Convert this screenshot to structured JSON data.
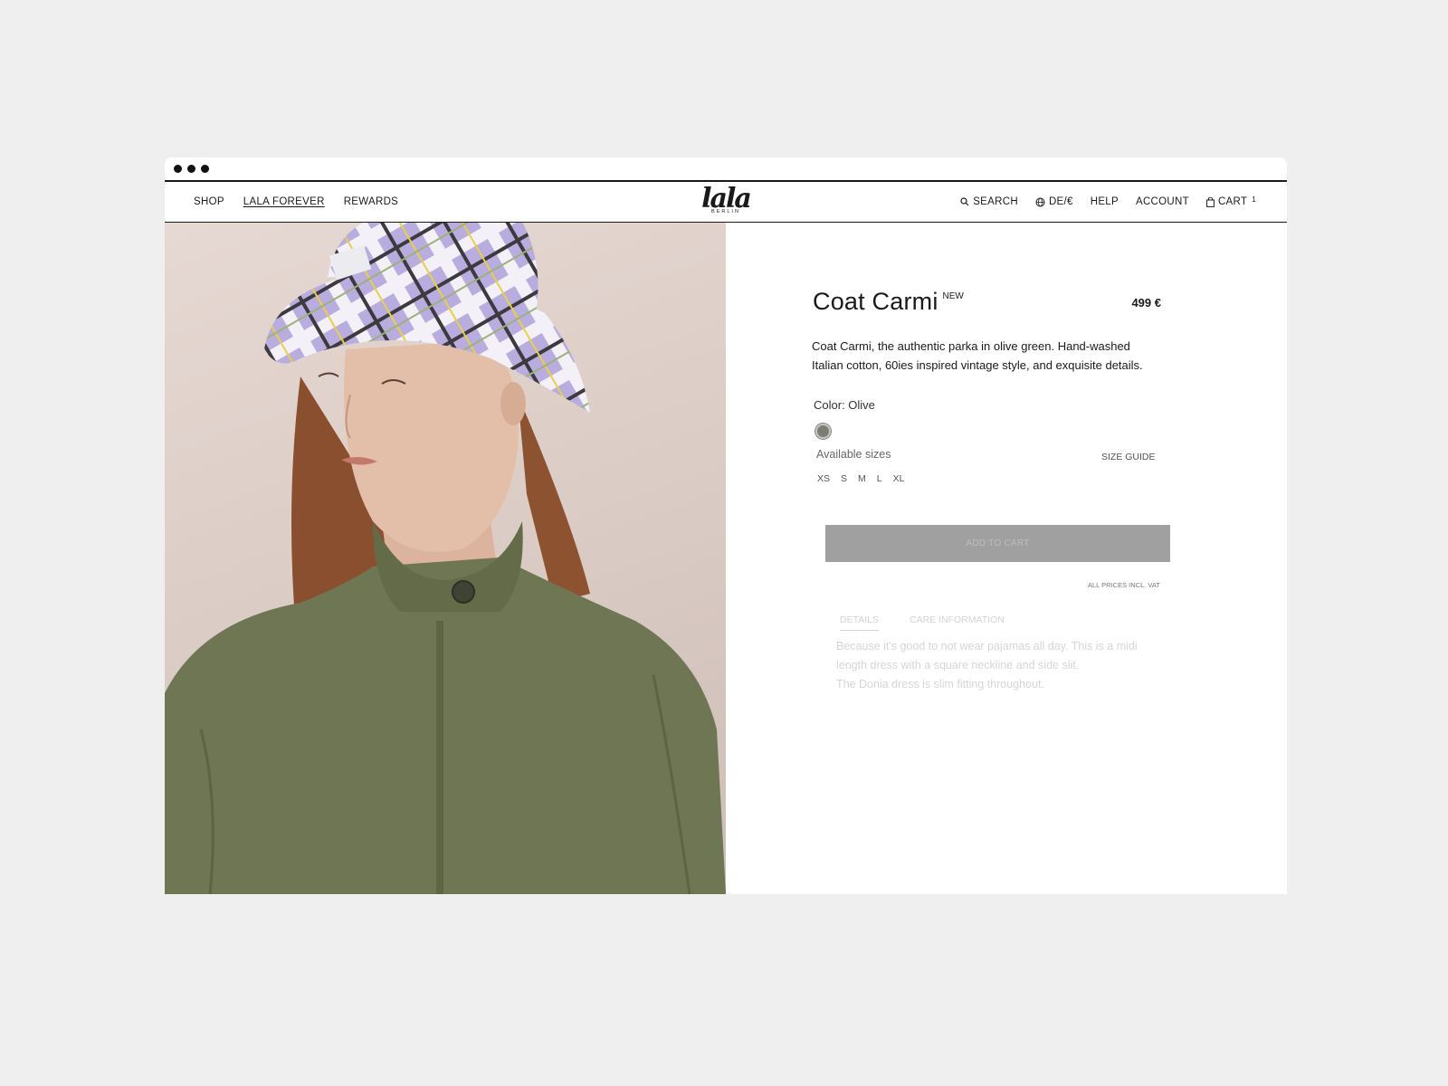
{
  "nav": {
    "left": [
      "SHOP",
      "LALA FOREVER",
      "REWARDS"
    ],
    "logo_script": "lala",
    "logo_sub": "BERLIN",
    "search": "SEARCH",
    "locale": "DE/€",
    "help": "HELP",
    "account": "ACCOUNT",
    "cart": "CART",
    "cart_count": "1"
  },
  "product": {
    "name": "Coat Carmi",
    "badge": "NEW",
    "price": "499 €",
    "description": "Coat Carmi, the authentic parka in olive green. Hand-washed Italian cotton, 60ies inspired vintage style, and exquisite details.",
    "color_label": "Color: Olive",
    "color_swatch": "#7b7e72",
    "available_sizes_label": "Available sizes",
    "size_guide": "SIZE GUIDE",
    "sizes": [
      "XS",
      "S",
      "M",
      "L",
      "XL"
    ],
    "add_to_cart": "ADD TO CART",
    "vat_note": "ALL PRICES INCL. VAT",
    "tabs": [
      "DETAILS",
      "CARE INFORMATION"
    ],
    "details_lines": [
      "Because it's good to not wear pajamas all day. This is a midi",
      "length dress with a square neckline and side slit.",
      "The Donia dress is slim fitting throughout."
    ]
  },
  "icons": {
    "search": "search-icon",
    "globe": "globe-icon",
    "bag": "bag-icon"
  }
}
